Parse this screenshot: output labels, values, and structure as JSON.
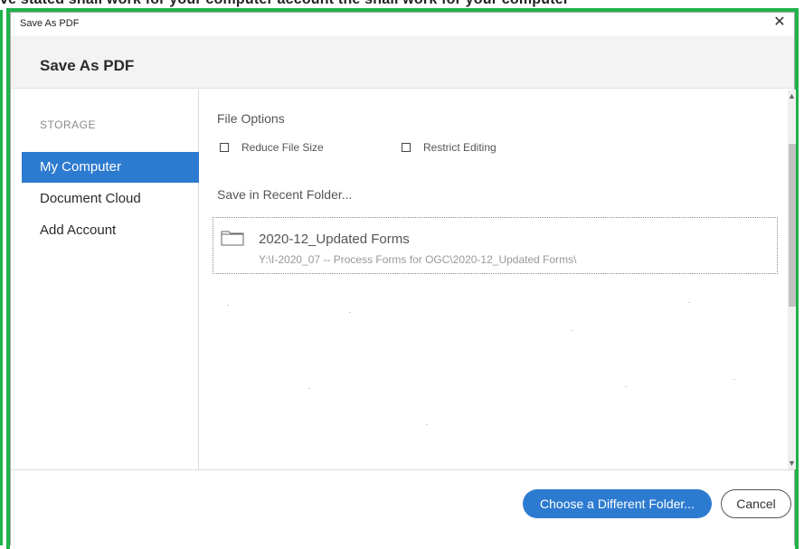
{
  "top_strip": {
    "text": "ve stated shall work for your computer account the shall work for your computer"
  },
  "window": {
    "title": "Save As PDF",
    "close_glyph": "✕"
  },
  "header": {
    "title": "Save As PDF"
  },
  "sidebar": {
    "section_label": "STORAGE",
    "items": [
      {
        "label": "My Computer",
        "active": true
      },
      {
        "label": "Document Cloud",
        "active": false
      },
      {
        "label": "Add Account",
        "active": false
      }
    ]
  },
  "file_options": {
    "label": "File Options",
    "checkboxes": [
      {
        "label": "Reduce File Size",
        "checked": false
      },
      {
        "label": "Restrict Editing",
        "checked": false
      }
    ]
  },
  "recent": {
    "label": "Save in Recent Folder...",
    "folders": [
      {
        "name": "2020-12_Updated Forms",
        "path": "Y:\\I-2020_07 -- Process Forms for OGC\\2020-12_Updated Forms\\",
        "icon": "folder-icon"
      }
    ]
  },
  "scrollbar": {
    "up_glyph": "▲",
    "down_glyph": "▼"
  },
  "footer": {
    "choose_label": "Choose a Different Folder...",
    "cancel_label": "Cancel"
  },
  "colors": {
    "accent": "#2d7bd0",
    "frame_green": "#1fb24a",
    "header_bg": "#f3f3f3"
  }
}
